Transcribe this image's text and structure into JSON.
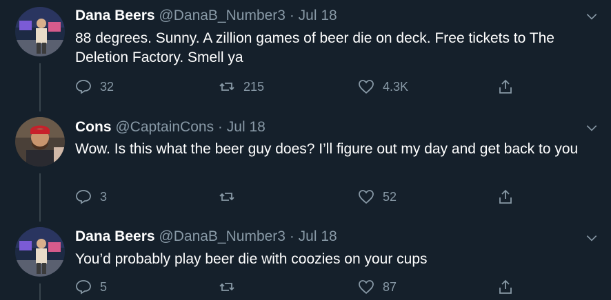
{
  "colors": {
    "background": "#15202b",
    "secondary_text": "#8899a6",
    "thread_line": "#38444d"
  },
  "tweets": [
    {
      "name": "Dana Beers",
      "handle": "@DanaB_Number3",
      "separator": "·",
      "date": "Jul 18",
      "text": "88 degrees. Sunny. A zillion games of beer die on deck. Free tickets to The Deletion Factory. Smell ya",
      "replies": "32",
      "retweets": "215",
      "likes": "4.3K",
      "icons": [
        "reply-icon",
        "retweet-icon",
        "like-icon",
        "share-icon",
        "chevron-down-icon"
      ]
    },
    {
      "name": "Cons",
      "handle": "@CaptainCons",
      "separator": "·",
      "date": "Jul 18",
      "text": "Wow. Is this what the beer guy does? I’ll figure out my day and get back to you",
      "replies": "3",
      "retweets": "",
      "likes": "52",
      "icons": [
        "reply-icon",
        "retweet-icon",
        "like-icon",
        "share-icon",
        "chevron-down-icon"
      ]
    },
    {
      "name": "Dana Beers",
      "handle": "@DanaB_Number3",
      "separator": "·",
      "date": "Jul 18",
      "text": "You’d probably play beer die with coozies on your cups",
      "replies": "5",
      "retweets": "",
      "likes": "87",
      "icons": [
        "reply-icon",
        "retweet-icon",
        "like-icon",
        "share-icon",
        "chevron-down-icon"
      ]
    }
  ]
}
